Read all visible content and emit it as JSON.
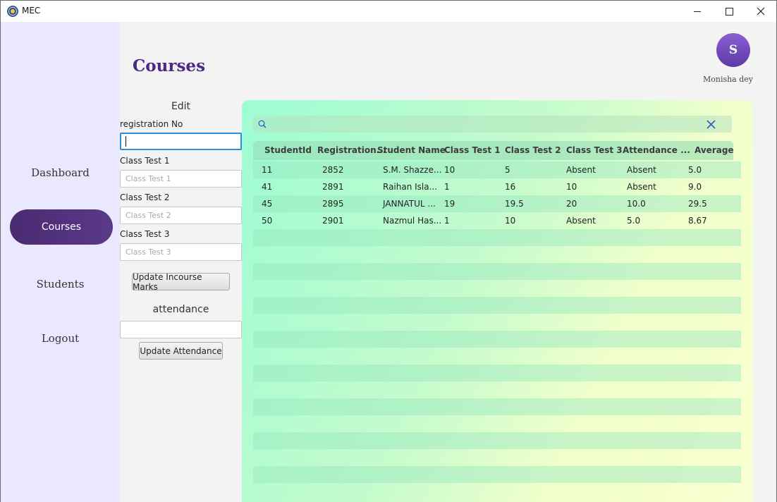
{
  "window": {
    "title": "MEC"
  },
  "sidebar": {
    "items": [
      {
        "label": "Dashboard"
      },
      {
        "label": "Courses"
      },
      {
        "label": "Students"
      },
      {
        "label": "Logout"
      }
    ]
  },
  "header": {
    "title": "Courses",
    "avatar_initial": "S",
    "user_name": "Monisha dey"
  },
  "edit": {
    "heading": "Edit",
    "reg_label": "registration No",
    "reg_value": "",
    "ct1_label": "Class Test 1",
    "ct1_placeholder": "Class Test 1",
    "ct2_label": "Class Test 2",
    "ct2_placeholder": "Class Test 2",
    "ct3_label": "Class Test 3",
    "ct3_placeholder": "Class Test 3",
    "update_marks_label": "Update Incourse Marks",
    "attendance_heading": "attendance",
    "attendance_value": "",
    "update_attendance_label": "Update Attendance"
  },
  "search": {
    "value": ""
  },
  "table": {
    "columns": [
      "StudentId",
      "Registration...",
      "Student Name",
      "Class Test 1",
      "Class Test 2",
      "Class Test 3",
      "Attendance ...",
      "Average"
    ],
    "rows": [
      [
        "11",
        "2852",
        "S.M. Shazze...",
        "10",
        "5",
        "Absent",
        "Absent",
        "5.0"
      ],
      [
        "41",
        "2891",
        "Raihan Isla...",
        "1",
        "16",
        "10",
        "Absent",
        "9.0"
      ],
      [
        "45",
        "2895",
        "JANNATUL ...",
        "19",
        "19.5",
        "20",
        "10.0",
        "29.5"
      ],
      [
        "50",
        "2901",
        "Nazmul Has...",
        "1",
        "10",
        "Absent",
        "5.0",
        "8.67"
      ]
    ]
  },
  "colors": {
    "accent": "#4b2a86",
    "nav_active": "#4a2a70",
    "focus": "#2c8fd8"
  }
}
